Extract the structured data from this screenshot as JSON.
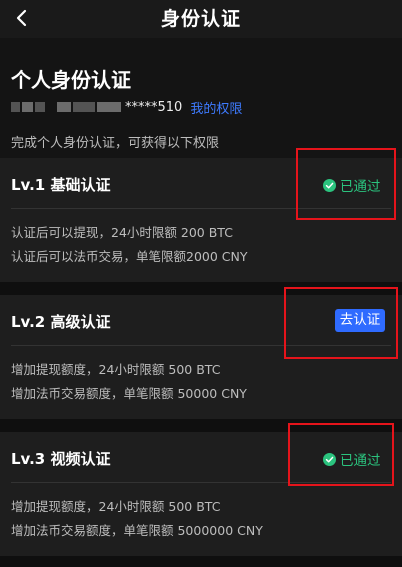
{
  "nav": {
    "title": "身份认证",
    "back_icon": "chevron-left-icon"
  },
  "info": {
    "heading": "个人身份认证",
    "account_masked": "*****510",
    "rights_link": "我的权限",
    "description": "完成个人身份认证，可获得以下权限"
  },
  "levels": [
    {
      "title": "Lv.1 基础认证",
      "status": "已通过",
      "lines": [
        "认证后可以提现，24小时限额 200 BTC",
        "认证后可以法币交易，单笔限额2000 CNY"
      ]
    },
    {
      "title": "Lv.2 高级认证",
      "button": "去认证",
      "lines": [
        "增加提现额度，24小时限额 500 BTC",
        "增加法币交易额度，单笔限额 50000 CNY"
      ]
    },
    {
      "title": "Lv.3 视频认证",
      "status": "已通过",
      "lines": [
        "增加提现额度，24小时限额 500 BTC",
        "增加法币交易额度，单笔限额 5000000 CNY"
      ]
    }
  ],
  "colors": {
    "accent": "#2f6bff",
    "success": "#2bc37e",
    "highlight": "#e5141b"
  }
}
